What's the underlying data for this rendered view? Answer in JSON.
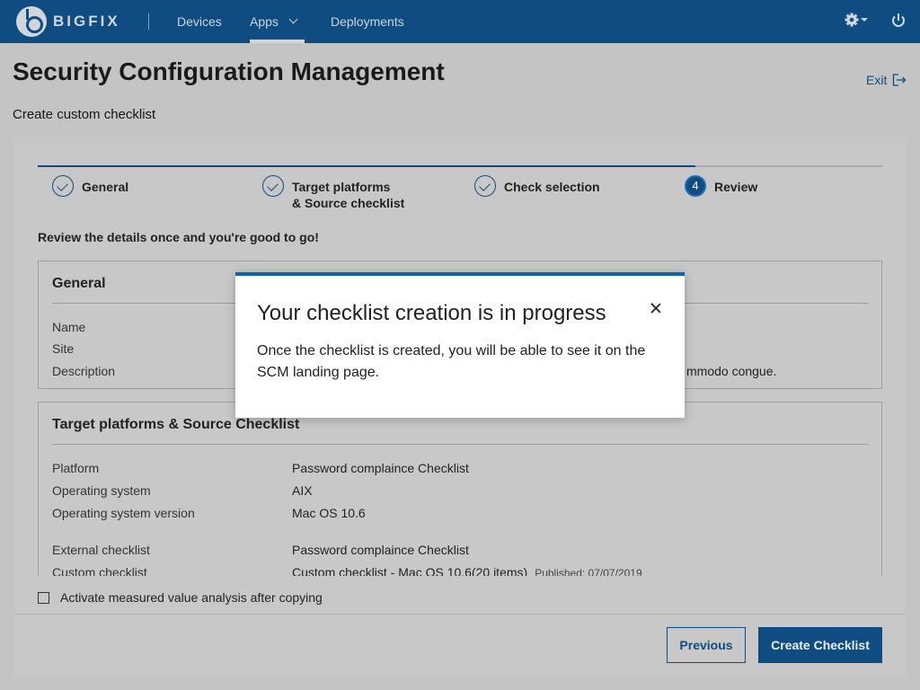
{
  "app": {
    "brand": "BIGFIX"
  },
  "nav": {
    "items": [
      {
        "label": "Devices"
      },
      {
        "label": "Apps"
      },
      {
        "label": "Deployments"
      }
    ],
    "icons": [
      "gear-icon",
      "chevron-down-icon",
      "power-icon"
    ]
  },
  "page": {
    "title": "Security Configuration Management",
    "exit_label": "Exit",
    "subtitle": "Create custom checklist"
  },
  "steps": [
    {
      "label": "General",
      "status": "complete"
    },
    {
      "label": "Target platforms\n& Source checklist",
      "line1": "Target platforms",
      "line2": "& Source checklist",
      "status": "complete"
    },
    {
      "label": "Check selection",
      "status": "complete"
    },
    {
      "number": "4",
      "label": "Review",
      "status": "current"
    }
  ],
  "review_intro": "Review the details once and you're good to go!",
  "general": {
    "title": "General",
    "rows": [
      {
        "label": "Name",
        "value": ""
      },
      {
        "label": "Site",
        "value": ""
      },
      {
        "label": "Description",
        "value": "mmodo congue."
      }
    ]
  },
  "target": {
    "title": "Target platforms & Source Checklist",
    "rows": [
      {
        "label": "Platform",
        "value": "Password complaince Checklist"
      },
      {
        "label": "Operating system",
        "value": "AIX"
      },
      {
        "label": "Operating system version",
        "value": "Mac OS 10.6"
      },
      {
        "label": "External checklist",
        "value": "Password complaince Checklist"
      },
      {
        "label": "Custom checklist",
        "value": "Custom checklist - Mac OS 10.6(20 items)",
        "published": "Published: 07/07/2019"
      }
    ]
  },
  "activate_label": "Activate measured value analysis after copying",
  "buttons": {
    "previous": "Previous",
    "create": "Create Checklist"
  },
  "modal": {
    "title": "Your checklist creation is in progress",
    "body": "Once the checklist is created, you will be able to see it on the SCM landing page."
  },
  "colors": {
    "brand": "#0f4c81",
    "modal_accent": "#0f62b4"
  }
}
